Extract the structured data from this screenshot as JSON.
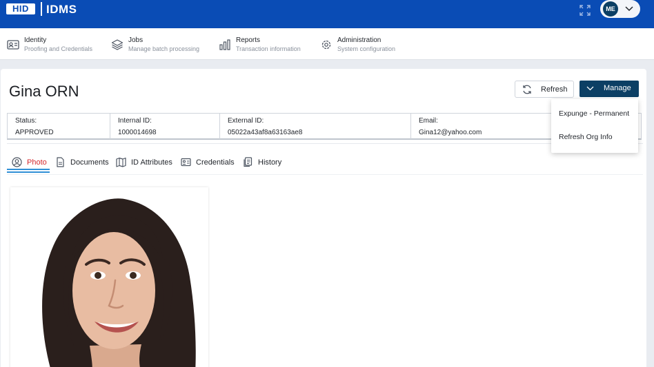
{
  "header": {
    "logo_text": "HID",
    "app_name": "IDMS",
    "user_initials": "ME",
    "brand_color": "#0a4cb5"
  },
  "nav": {
    "items": [
      {
        "title": "Identity",
        "subtitle": "Proofing and Credentials",
        "icon": "id-card-icon"
      },
      {
        "title": "Jobs",
        "subtitle": "Manage batch processing",
        "icon": "layers-icon"
      },
      {
        "title": "Reports",
        "subtitle": "Transaction information",
        "icon": "bar-chart-icon"
      },
      {
        "title": "Administration",
        "subtitle": "System configuration",
        "icon": "gear-icon"
      }
    ]
  },
  "page": {
    "title": "Gina ORN",
    "refresh_label": "Refresh",
    "manage_label": "Manage",
    "manage_color": "#0c3f64"
  },
  "info": [
    {
      "label": "Status:",
      "value": "APPROVED"
    },
    {
      "label": "Internal ID:",
      "value": "1000014698"
    },
    {
      "label": "External ID:",
      "value": "05022a43af8a63163ae8"
    },
    {
      "label": "Email:",
      "value": "Gina12@yahoo.com"
    }
  ],
  "tabs": [
    {
      "label": "Photo",
      "icon": "user-circle-icon",
      "active": true
    },
    {
      "label": "Documents",
      "icon": "document-icon",
      "active": false
    },
    {
      "label": "ID Attributes",
      "icon": "map-icon",
      "active": false
    },
    {
      "label": "Credentials",
      "icon": "id-card-icon",
      "active": false
    },
    {
      "label": "History",
      "icon": "history-icon",
      "active": false
    }
  ],
  "manage_menu": {
    "items": [
      {
        "label": "Expunge - Permanent"
      },
      {
        "label": "Refresh Org Info"
      }
    ]
  }
}
